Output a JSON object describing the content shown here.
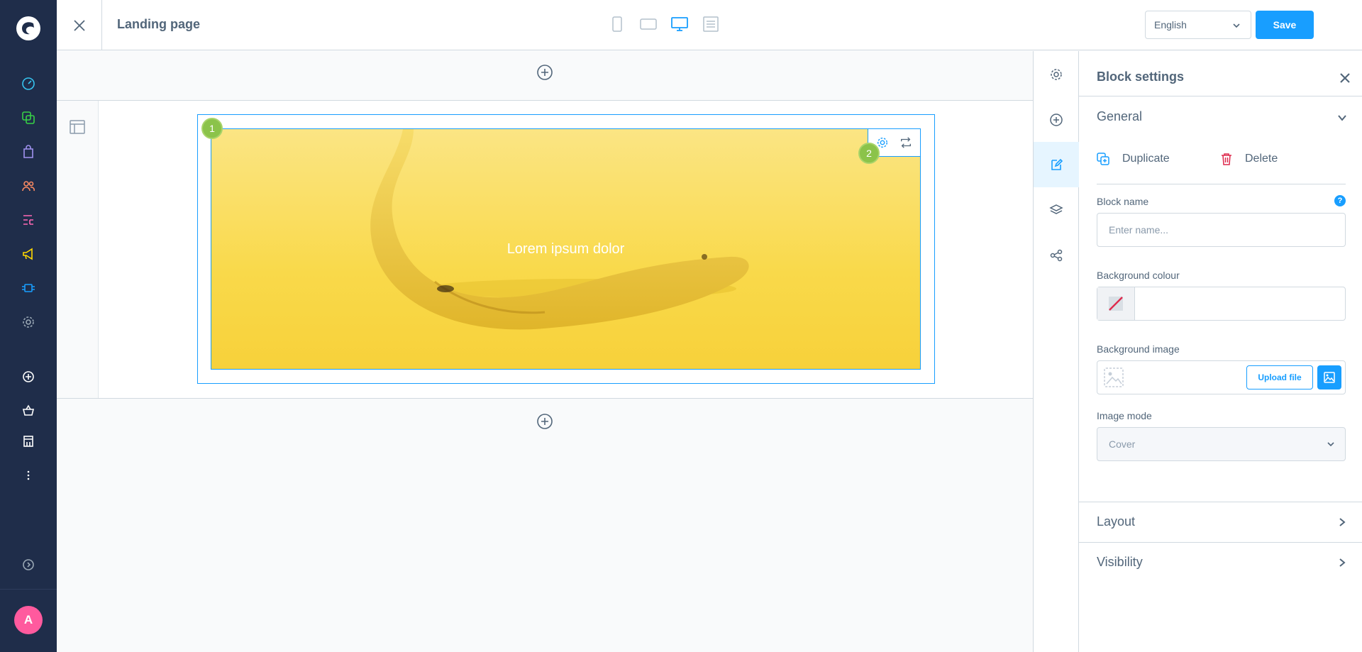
{
  "app": {
    "avatar_initial": "A",
    "brand_color": "#189eff",
    "sidebar_bg": "#1f2d4a",
    "sidebar_icons": [
      "dashboard-icon",
      "catalogues-icon",
      "orders-icon",
      "customers-icon",
      "content-icon",
      "marketing-icon",
      "extensions-icon",
      "settings-icon",
      "add-icon",
      "basket-icon",
      "store-icon",
      "more-icon",
      "expand-icon"
    ]
  },
  "header": {
    "title": "Landing page",
    "devices": [
      "mobile-icon",
      "tablet-icon",
      "desktop-icon",
      "form-icon"
    ],
    "active_device": "desktop-icon",
    "language": "English",
    "save_label": "Save"
  },
  "canvas": {
    "block_text": "Lorem ipsum dolor",
    "badges": [
      "1",
      "2"
    ],
    "block_image": "banana on yellow background"
  },
  "panel": {
    "title": "Block settings",
    "general_label": "General",
    "duplicate_label": "Duplicate",
    "delete_label": "Delete",
    "block_name_label": "Block name",
    "block_name_placeholder": "Enter name...",
    "block_name_value": "",
    "bg_colour_label": "Background colour",
    "bg_colour_value": "",
    "bg_image_label": "Background image",
    "upload_label": "Upload file",
    "image_mode_label": "Image mode",
    "image_mode_value": "Cover",
    "layout_label": "Layout",
    "visibility_label": "Visibility",
    "help_symbol": "?"
  }
}
